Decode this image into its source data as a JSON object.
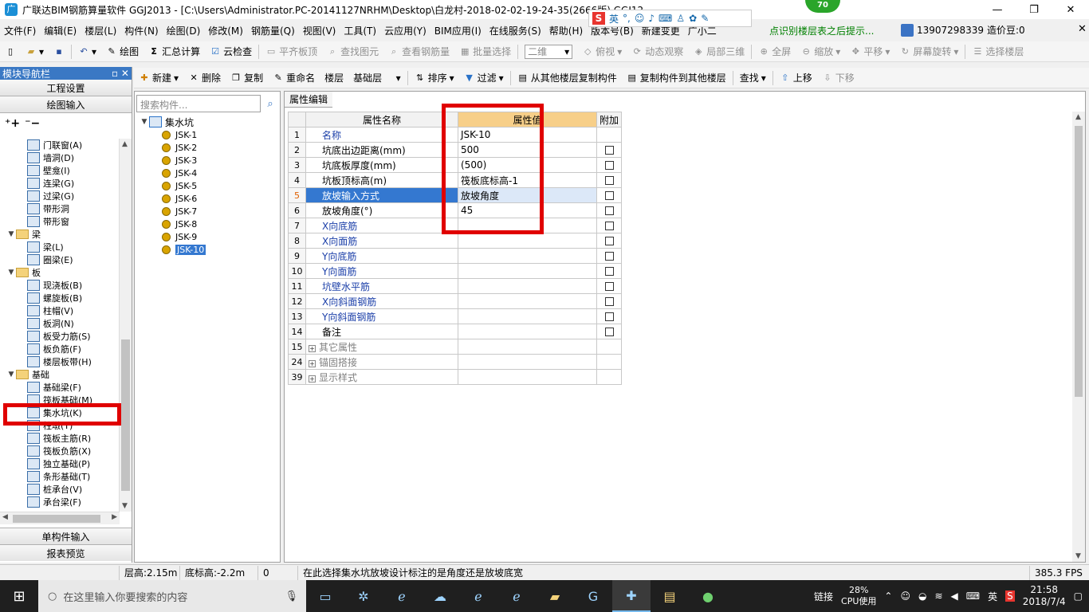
{
  "window": {
    "title": "广联达BIM钢筋算量软件 GGJ2013 - [C:\\Users\\Administrator.PC-20141127NRHM\\Desktop\\白龙村-2018-02-02-19-24-35(2666版).GGJ12]",
    "score": "70"
  },
  "ime": {
    "lang": "英"
  },
  "menu": {
    "items": [
      "文件(F)",
      "编辑(E)",
      "楼层(L)",
      "构件(N)",
      "绘图(D)",
      "修改(M)",
      "钢筋量(Q)",
      "视图(V)",
      "工具(T)",
      "云应用(Y)",
      "BIM应用(I)",
      "在线服务(S)",
      "帮助(H)",
      "版本号(B)",
      "新建变更",
      "广小二"
    ],
    "hint": "点识别楼层表之后提示...",
    "phone": "13907298339",
    "beans": "造价豆:0"
  },
  "toolbar1": {
    "draw": "绘图",
    "calc": "汇总计算",
    "cloud_check": "云检查",
    "flat_top": "平齐板顶",
    "find_elem": "查找图元",
    "view_rebar": "查看钢筋量",
    "batch_select": "批量选择",
    "view_mode": "二维",
    "top_view": "俯视",
    "dyn_view": "动态观察",
    "local_3d": "局部三维",
    "fullscreen": "全屏",
    "zoom": "缩放",
    "pan": "平移",
    "rotate": "屏幕旋转",
    "select_floor": "选择楼层"
  },
  "toolbar2": {
    "new": "新建",
    "delete": "删除",
    "copy": "复制",
    "rename": "重命名",
    "floor_label": "楼层",
    "floor_value": "基础层",
    "sort": "排序",
    "filter": "过滤",
    "copy_from": "从其他楼层复制构件",
    "copy_to": "复制构件到其他楼层",
    "find": "查找",
    "move_up": "上移",
    "move_down": "下移"
  },
  "nav": {
    "header": "模块导航栏",
    "project_settings": "工程设置",
    "drawing_input": "绘图输入",
    "single_input": "单构件输入",
    "report_preview": "报表预览",
    "tree": [
      {
        "label": "门联窗(A)",
        "level": 2,
        "type": "item"
      },
      {
        "label": "墙洞(D)",
        "level": 2,
        "type": "item"
      },
      {
        "label": "壁龛(I)",
        "level": 2,
        "type": "item"
      },
      {
        "label": "连梁(G)",
        "level": 2,
        "type": "item"
      },
      {
        "label": "过梁(G)",
        "level": 2,
        "type": "item"
      },
      {
        "label": "带形洞",
        "level": 2,
        "type": "item"
      },
      {
        "label": "带形窗",
        "level": 2,
        "type": "item"
      },
      {
        "label": "梁",
        "level": 1,
        "type": "folder"
      },
      {
        "label": "梁(L)",
        "level": 2,
        "type": "item"
      },
      {
        "label": "圈梁(E)",
        "level": 2,
        "type": "item"
      },
      {
        "label": "板",
        "level": 1,
        "type": "folder"
      },
      {
        "label": "现浇板(B)",
        "level": 2,
        "type": "item"
      },
      {
        "label": "螺旋板(B)",
        "level": 2,
        "type": "item"
      },
      {
        "label": "柱帽(V)",
        "level": 2,
        "type": "item"
      },
      {
        "label": "板洞(N)",
        "level": 2,
        "type": "item"
      },
      {
        "label": "板受力筋(S)",
        "level": 2,
        "type": "item"
      },
      {
        "label": "板负筋(F)",
        "level": 2,
        "type": "item"
      },
      {
        "label": "楼层板带(H)",
        "level": 2,
        "type": "item"
      },
      {
        "label": "基础",
        "level": 1,
        "type": "folder"
      },
      {
        "label": "基础梁(F)",
        "level": 2,
        "type": "item"
      },
      {
        "label": "筏板基础(M)",
        "level": 2,
        "type": "item"
      },
      {
        "label": "集水坑(K)",
        "level": 2,
        "type": "item"
      },
      {
        "label": "柱墩(Y)",
        "level": 2,
        "type": "item"
      },
      {
        "label": "筏板主筋(R)",
        "level": 2,
        "type": "item"
      },
      {
        "label": "筏板负筋(X)",
        "level": 2,
        "type": "item"
      },
      {
        "label": "独立基础(P)",
        "level": 2,
        "type": "item"
      },
      {
        "label": "条形基础(T)",
        "level": 2,
        "type": "item"
      },
      {
        "label": "桩承台(V)",
        "level": 2,
        "type": "item"
      },
      {
        "label": "承台梁(F)",
        "level": 2,
        "type": "item"
      }
    ]
  },
  "components": {
    "search_placeholder": "搜索构件...",
    "root": "集水坑",
    "items": [
      "JSK-1",
      "JSK-2",
      "JSK-3",
      "JSK-4",
      "JSK-5",
      "JSK-6",
      "JSK-7",
      "JSK-8",
      "JSK-9",
      "JSK-10"
    ],
    "selected": "JSK-10"
  },
  "props": {
    "tab": "属性编辑",
    "headers": {
      "name": "属性名称",
      "value": "属性值",
      "extra": "附加"
    },
    "rows": [
      {
        "num": "1",
        "name": "名称",
        "value": "JSK-10",
        "style": "blue",
        "check": false
      },
      {
        "num": "2",
        "name": "坑底出边距离(mm)",
        "value": "500",
        "style": "normal",
        "check": true
      },
      {
        "num": "3",
        "name": "坑底板厚度(mm)",
        "value": "(500)",
        "style": "normal",
        "check": true
      },
      {
        "num": "4",
        "name": "坑板顶标高(m)",
        "value": "筏板底标高-1",
        "style": "normal",
        "check": true
      },
      {
        "num": "5",
        "name": "放坡输入方式",
        "value": "放坡角度",
        "style": "selected",
        "check": true
      },
      {
        "num": "6",
        "name": "放坡角度(°)",
        "value": "45",
        "style": "normal",
        "check": true
      },
      {
        "num": "7",
        "name": "X向底筋",
        "value": "",
        "style": "blue",
        "check": true
      },
      {
        "num": "8",
        "name": "X向面筋",
        "value": "",
        "style": "blue",
        "check": true
      },
      {
        "num": "9",
        "name": "Y向底筋",
        "value": "",
        "style": "blue",
        "check": true
      },
      {
        "num": "10",
        "name": "Y向面筋",
        "value": "",
        "style": "blue",
        "check": true
      },
      {
        "num": "11",
        "name": "坑壁水平筋",
        "value": "",
        "style": "blue",
        "check": true
      },
      {
        "num": "12",
        "name": "X向斜面钢筋",
        "value": "",
        "style": "blue",
        "check": true
      },
      {
        "num": "13",
        "name": "Y向斜面钢筋",
        "value": "",
        "style": "blue",
        "check": true
      },
      {
        "num": "14",
        "name": "备注",
        "value": "",
        "style": "normal",
        "check": true
      },
      {
        "num": "15",
        "name": "其它属性",
        "value": "",
        "style": "group",
        "check": false
      },
      {
        "num": "24",
        "name": "锚固搭接",
        "value": "",
        "style": "group",
        "check": false
      },
      {
        "num": "39",
        "name": "显示样式",
        "value": "",
        "style": "group",
        "check": false
      }
    ]
  },
  "status": {
    "floor_height": "层高:2.15m",
    "bottom_elev": "底标高:-2.2m",
    "zero": "0",
    "message": "在此选择集水坑放坡设计标注的是角度还是放坡底宽",
    "fps": "385.3 FPS"
  },
  "taskbar": {
    "search_placeholder": "在这里输入你要搜索的内容",
    "link": "链接",
    "cpu_percent": "28%",
    "cpu_label": "CPU使用",
    "lang": "英",
    "time": "21:58",
    "date": "2018/7/4"
  },
  "colors": {
    "accent_red": "#e00000",
    "selection_blue": "#3478d0",
    "value_header": "#f7cf89"
  }
}
